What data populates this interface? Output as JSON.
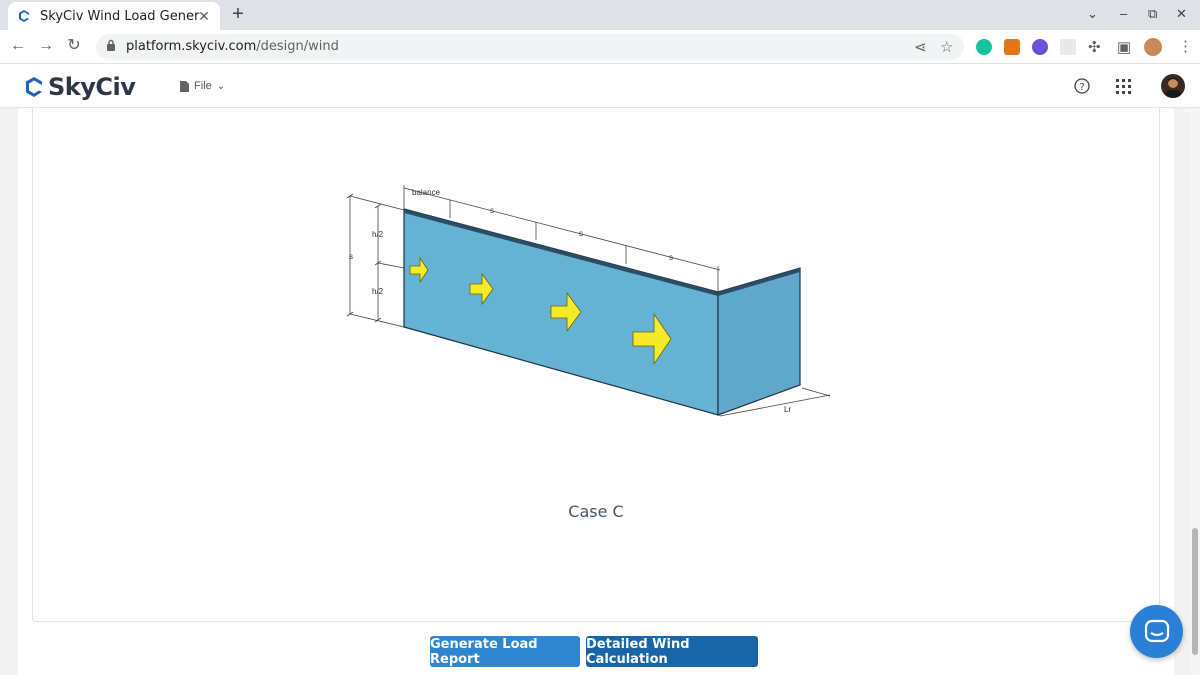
{
  "browser": {
    "tab_title": "SkyCiv Wind Load Genera",
    "tab_close": "✕",
    "new_tab": "+",
    "url_host": "platform.skyciv.com",
    "url_path": "/design/wind"
  },
  "app": {
    "logo_text": "SkyCiv",
    "file_menu": "File"
  },
  "diagram": {
    "labels": {
      "balance": "balance",
      "s": "s",
      "h_half": "h/2",
      "lr": "Lr"
    },
    "colors": {
      "wall_face": "#66b2d3",
      "wall_side": "#5fa8cc",
      "arrow": "#f5ea2a",
      "arrow_shade": "#c8bc10"
    }
  },
  "main": {
    "case_label": "Case C",
    "buttons": {
      "generate_report": "Generate Load Report",
      "detailed_calc": "Detailed Wind Calculation"
    }
  },
  "colors": {
    "primary_button": "#2f86d0",
    "secondary_button": "#1866a8",
    "chat_button": "#2b80d5"
  }
}
